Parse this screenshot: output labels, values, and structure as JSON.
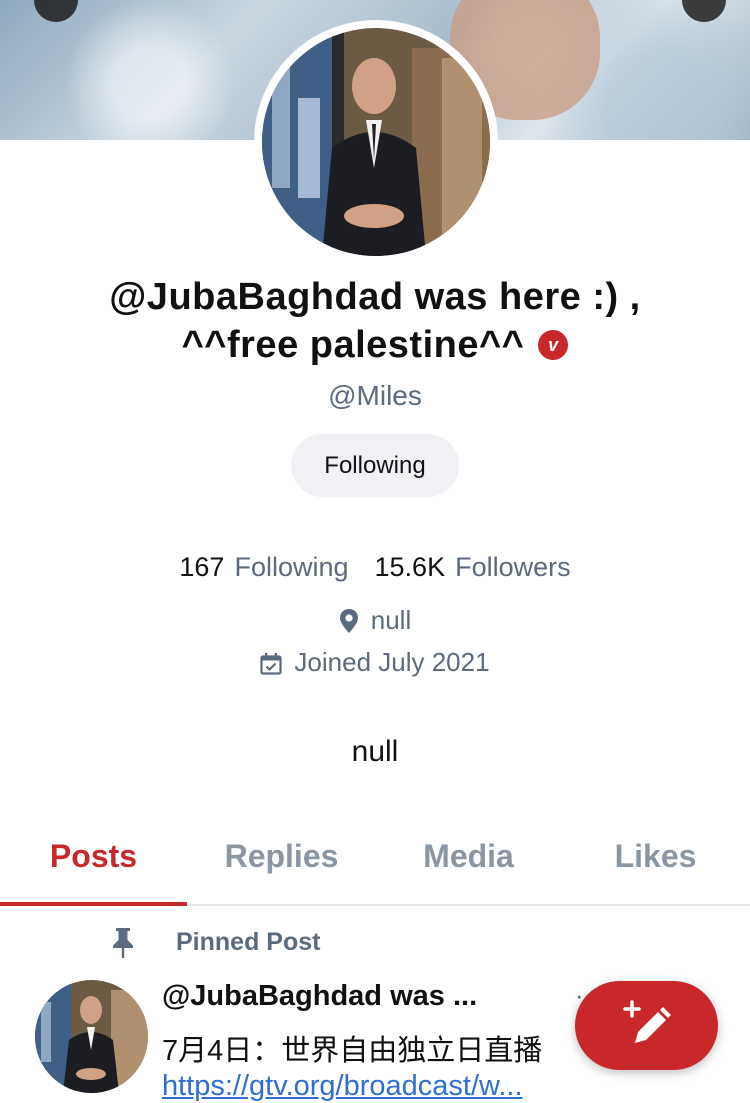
{
  "profile": {
    "display_name_line1": "@JubaBaghdad was here :) ,",
    "display_name_line2": "^^free palestine^^",
    "verified_badge": "v",
    "handle": "@Miles",
    "follow_button_label": "Following",
    "following_count": "167",
    "following_label": "Following",
    "followers_count": "15.6K",
    "followers_label": "Followers",
    "location": "null",
    "joined": "Joined July 2021",
    "bio": "null"
  },
  "tabs": [
    {
      "label": "Posts",
      "active": true
    },
    {
      "label": "Replies",
      "active": false
    },
    {
      "label": "Media",
      "active": false
    },
    {
      "label": "Likes",
      "active": false
    }
  ],
  "pinned_post": {
    "pinned_label": "Pinned Post",
    "author": "@JubaBaghdad was ...",
    "more": "· · ·",
    "text": "7月4日：世界自由独立日直播",
    "link": "https://gtv.org/broadcast/w..."
  },
  "icons": {
    "location": "map-pin-icon",
    "calendar": "calendar-check-icon",
    "pin": "pushpin-icon",
    "compose": "compose-pencil-icon"
  },
  "colors": {
    "accent": "#c8282a",
    "muted": "#5b6b7d",
    "link": "#2e6fd1"
  }
}
